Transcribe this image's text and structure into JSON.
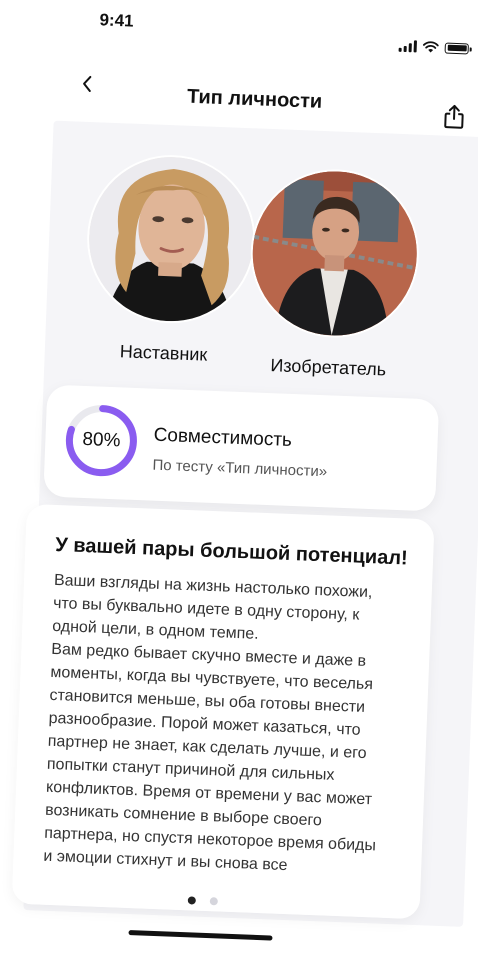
{
  "status_bar": {
    "time": "9:41"
  },
  "nav": {
    "title": "Тип личности",
    "back_icon": "chevron-left-icon",
    "share_icon": "share-icon"
  },
  "partners": [
    {
      "label": "Наставник"
    },
    {
      "label": "Изобретатель"
    }
  ],
  "compatibility": {
    "percent": 80,
    "percent_label": "80%",
    "title": "Совместимость",
    "subtitle": "По тесту «Тип личности»",
    "ring_color": "#8a5cf0",
    "ring_track_color": "#e9e9ee"
  },
  "description": {
    "title": "У вашей пары большой потенциал!",
    "body": "Ваши взгляды на жизнь настолько похожи, что вы буквально идете в одну сторону, к одной цели, в одном темпе.\nВам редко бывает скучно вместе и даже в моменты, когда вы чувствуете, что веселья становится меньше, вы оба готовы внести разнообразие. Порой может казаться, что партнер не знает, как сделать лучше, и его попытки станут причиной для сильных конфликтов. Время от времени у вас может возникать сомнение в выборе своего партнера, но спустя некоторое время обиды и эмоции стихнут и вы снова все"
  },
  "pager": {
    "count": 2,
    "active_index": 0
  }
}
